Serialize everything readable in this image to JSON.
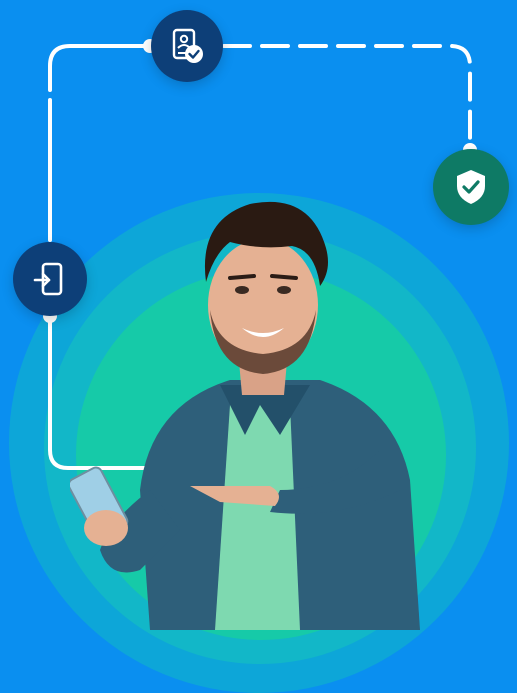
{
  "illustration": {
    "icons": {
      "verified_document": "verified-document-icon",
      "phone_login": "phone-login-icon",
      "security_shield": "shield-check-icon"
    },
    "colors": {
      "background": "#0a8ff0",
      "ring_outer": "#0da6d8",
      "ring_middle": "#12b7c8",
      "ring_inner": "#16caa8",
      "node_navy": "#0d3f78",
      "node_green": "#0e7a65",
      "connector": "#ffffff"
    }
  }
}
